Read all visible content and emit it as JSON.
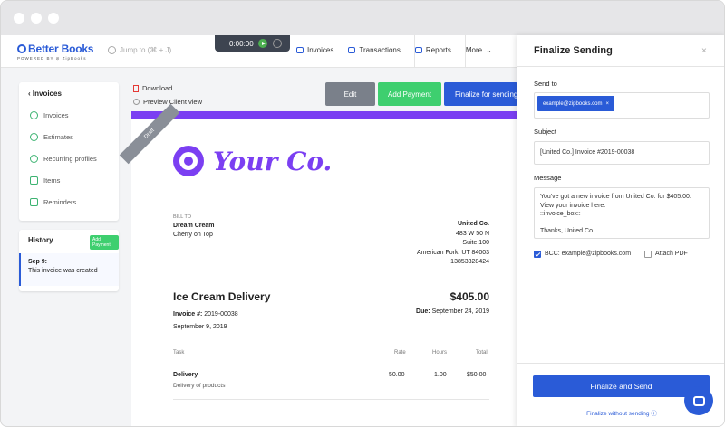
{
  "app": {
    "logo_title": "Better Books",
    "logo_sub": "POWERED BY ⊘ ZipBooks",
    "search_placeholder": "Jump to (⌘ + J)",
    "timer": "0:00:00"
  },
  "nav": {
    "items": [
      {
        "label": "Invoices",
        "icon": "invoice-icon"
      },
      {
        "label": "Transactions",
        "icon": "transactions-icon"
      },
      {
        "label": "Reports",
        "icon": "reports-icon"
      },
      {
        "label": "More",
        "icon": "chevron-down-icon"
      }
    ]
  },
  "sidebar": {
    "back_label": "Invoices",
    "items": [
      {
        "label": "Invoices",
        "icon": "dollar-icon"
      },
      {
        "label": "Estimates",
        "icon": "dollar-icon"
      },
      {
        "label": "Recurring profiles",
        "icon": "refresh-icon"
      },
      {
        "label": "Items",
        "icon": "tag-icon"
      },
      {
        "label": "Reminders",
        "icon": "bell-icon"
      }
    ]
  },
  "history": {
    "title": "History",
    "badge": "Add Payment",
    "entry_date": "Sep 9:",
    "entry_text": "This invoice was created"
  },
  "actions": {
    "download": "Download",
    "preview": "Preview Client view",
    "edit": "Edit",
    "add_payment": "Add Payment",
    "finalize": "Finalize for sending"
  },
  "invoice": {
    "draft": "Draft",
    "company_logo_text": "Your Co.",
    "bill_to_label": "BILL TO",
    "bill_to_name": "Dream Cream",
    "bill_to_addr": "Cherry on Top",
    "sender_name": "United Co.",
    "sender_lines": [
      "483 W 50 N",
      "Suite 100",
      "American Fork, UT 84003",
      "13853328424"
    ],
    "title": "Ice Cream Delivery",
    "amount": "$405.00",
    "number_label": "Invoice #:",
    "number": "2019-00038",
    "date": "September 9, 2019",
    "due_label": "Due:",
    "due": "September 24, 2019",
    "table": {
      "headers": [
        "Task",
        "Rate",
        "Hours",
        "Total"
      ],
      "rows": [
        {
          "task": "Delivery",
          "desc": "Delivery of products",
          "rate": "50.00",
          "hours": "1.00",
          "total": "$50.00"
        }
      ]
    }
  },
  "panel": {
    "title": "Finalize Sending",
    "close": "×",
    "send_to_label": "Send to",
    "recipient": "example@zipbooks.com",
    "chip_close": "×",
    "subject_label": "Subject",
    "subject": "[United Co.] Invoice #2019-00038",
    "message_label": "Message",
    "message": "You've got a new invoice from United Co. for $405.00. View your invoice here:\n::invoice_box::\n\nThanks, United Co.",
    "bcc_label": "BCC: example@zipbooks.com",
    "attach_label": "Attach PDF",
    "bcc_checked": true,
    "attach_checked": false,
    "send_button": "Finalize and Send",
    "finalize_without": "Finalize without sending ⓘ"
  },
  "colors": {
    "brand": "#2a5bd7",
    "green": "#3ecf6f",
    "purple": "#7b3ff2",
    "gray_button": "#7a808a"
  }
}
